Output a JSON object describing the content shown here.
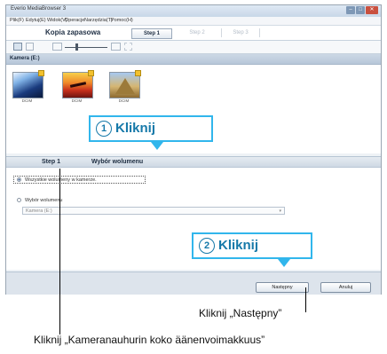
{
  "window": {
    "title": "Everio MediaBrowser 3",
    "controls": {
      "minimize": "–",
      "maximize": "□",
      "close": "✕"
    }
  },
  "menu": [
    "Plik(F)",
    "Edytuj(E)",
    "Widok(V)",
    "Operacje",
    "Narzędzia(T)",
    "Pomoc(H)"
  ],
  "mode": {
    "title": "Kopia zapasowa"
  },
  "steps": [
    "Step 1",
    "Step 2",
    "Step 3"
  ],
  "toolbar": {
    "icons": [
      "grid-view-icon",
      "list-view-icon",
      "thumbnail-size-small-icon",
      "thumbnail-size-large-icon",
      "preview-icon"
    ]
  },
  "camera": {
    "label": "Kamera (E:)"
  },
  "thumbnails": [
    {
      "caption": "DCIM",
      "icon": "folder-thumbnail"
    },
    {
      "caption": "DCIM",
      "icon": "folder-thumbnail"
    },
    {
      "caption": "DCIM",
      "icon": "folder-thumbnail"
    }
  ],
  "step_header": {
    "number": "Step 1",
    "title": "Wybór wolumenu"
  },
  "options": {
    "all_volumes": "Wszystkie wolumeny w kamerze.",
    "select_volume": "Wybór wolumenu",
    "volume_dropdown": "Kamera (E:)"
  },
  "buttons": {
    "next": "Następny",
    "cancel": "Anuluj"
  },
  "callouts": [
    {
      "number": "1",
      "text": "Kliknij"
    },
    {
      "number": "2",
      "text": "Kliknij"
    }
  ],
  "annotations": {
    "next_label": "Kliknij „Następny”",
    "volume_label": "Kliknij „Kameranauhurin koko äänenvoimakkuus”"
  },
  "colors": {
    "callout_border": "#31b6ec",
    "callout_text": "#1679a9",
    "selection_header": "#b7c7d9"
  }
}
